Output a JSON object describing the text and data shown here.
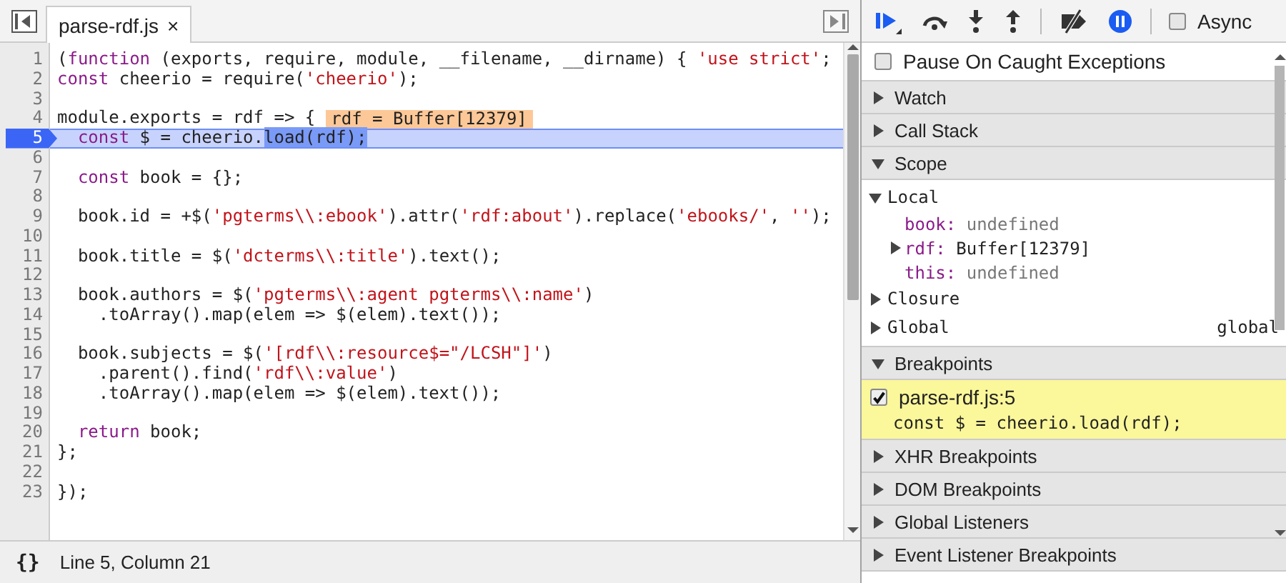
{
  "editor": {
    "tabs": [
      {
        "label": "parse-rdf.js",
        "close": "×",
        "selected": true
      }
    ],
    "lines": [
      {
        "number": "1",
        "current": false,
        "tokens": [
          {
            "kind": "plain",
            "text": "("
          },
          {
            "kind": "keyword",
            "text": "function"
          },
          {
            "kind": "plain",
            "text": " (exports, require, module, __filename, __dirname) { "
          },
          {
            "kind": "string",
            "text": "'use strict'"
          },
          {
            "kind": "plain",
            "text": ";"
          }
        ]
      },
      {
        "number": "2",
        "current": false,
        "tokens": [
          {
            "kind": "keyword",
            "text": "const"
          },
          {
            "kind": "plain",
            "text": " cheerio = require("
          },
          {
            "kind": "string",
            "text": "'cheerio'"
          },
          {
            "kind": "plain",
            "text": ");"
          }
        ]
      },
      {
        "number": "3",
        "current": false
      },
      {
        "number": "4",
        "current": false,
        "tokens": [
          {
            "kind": "plain",
            "text": "module.exports = rdf => {"
          }
        ],
        "inline_value": "rdf = Buffer[12379]"
      },
      {
        "number": "5",
        "current": true,
        "tokens": [
          {
            "kind": "keyword",
            "text": "  const"
          },
          {
            "kind": "plain",
            "text": " $ = cheerio."
          },
          {
            "kind": "selection",
            "text": "load(rdf);"
          }
        ]
      },
      {
        "number": "6",
        "current": false
      },
      {
        "number": "7",
        "current": false,
        "tokens": [
          {
            "kind": "keyword",
            "text": "  const"
          },
          {
            "kind": "plain",
            "text": " book = {};"
          }
        ]
      },
      {
        "number": "8",
        "current": false
      },
      {
        "number": "9",
        "current": false,
        "tokens": [
          {
            "kind": "plain",
            "text": "  book.id = +$("
          },
          {
            "kind": "string",
            "text": "'pgterms\\\\:ebook'"
          },
          {
            "kind": "plain",
            "text": ").attr("
          },
          {
            "kind": "string",
            "text": "'rdf:about'"
          },
          {
            "kind": "plain",
            "text": ").replace("
          },
          {
            "kind": "string",
            "text": "'ebooks/'"
          },
          {
            "kind": "plain",
            "text": ", "
          },
          {
            "kind": "string",
            "text": "''"
          },
          {
            "kind": "plain",
            "text": ");"
          }
        ]
      },
      {
        "number": "10",
        "current": false
      },
      {
        "number": "11",
        "current": false,
        "tokens": [
          {
            "kind": "plain",
            "text": "  book.title = $("
          },
          {
            "kind": "string",
            "text": "'dcterms\\\\:title'"
          },
          {
            "kind": "plain",
            "text": ").text();"
          }
        ]
      },
      {
        "number": "12",
        "current": false
      },
      {
        "number": "13",
        "current": false,
        "tokens": [
          {
            "kind": "plain",
            "text": "  book.authors = $("
          },
          {
            "kind": "string",
            "text": "'pgterms\\\\:agent pgterms\\\\:name'"
          },
          {
            "kind": "plain",
            "text": ")"
          }
        ]
      },
      {
        "number": "14",
        "current": false,
        "tokens": [
          {
            "kind": "plain",
            "text": "    .toArray().map(elem => $(elem).text());"
          }
        ]
      },
      {
        "number": "15",
        "current": false
      },
      {
        "number": "16",
        "current": false,
        "tokens": [
          {
            "kind": "plain",
            "text": "  book.subjects = $("
          },
          {
            "kind": "string",
            "text": "'[rdf\\\\:resource$=\"/LCSH\"]'"
          },
          {
            "kind": "plain",
            "text": ")"
          }
        ]
      },
      {
        "number": "17",
        "current": false,
        "tokens": [
          {
            "kind": "plain",
            "text": "    .parent().find("
          },
          {
            "kind": "string",
            "text": "'rdf\\\\:value'"
          },
          {
            "kind": "plain",
            "text": ")"
          }
        ]
      },
      {
        "number": "18",
        "current": false,
        "tokens": [
          {
            "kind": "plain",
            "text": "    .toArray().map(elem => $(elem).text());"
          }
        ]
      },
      {
        "number": "19",
        "current": false
      },
      {
        "number": "20",
        "current": false,
        "tokens": [
          {
            "kind": "keyword",
            "text": "  return"
          },
          {
            "kind": "plain",
            "text": " book;"
          }
        ]
      },
      {
        "number": "21",
        "current": false,
        "tokens": [
          {
            "kind": "plain",
            "text": "};"
          }
        ]
      },
      {
        "number": "22",
        "current": false
      },
      {
        "number": "23",
        "current": false,
        "tokens": [
          {
            "kind": "plain",
            "text": "});"
          }
        ]
      }
    ],
    "status_bar": {
      "format_button": "{}",
      "position": "Line 5, Column 21"
    }
  },
  "debugger": {
    "toolbar": {
      "pause_on_exceptions": true,
      "async": {
        "label": "Async",
        "checked": false
      }
    },
    "pause_on_caught": {
      "label": "Pause On Caught Exceptions",
      "checked": false
    },
    "sections": [
      {
        "title": "Watch",
        "kind": "plain",
        "expanded": false
      },
      {
        "title": "Call Stack",
        "kind": "plain",
        "expanded": false
      },
      {
        "title": "Scope",
        "kind": "scope",
        "expanded": true,
        "scopes": [
          {
            "label": "Local",
            "expanded": true,
            "variables": [
              {
                "name": "book:",
                "value": "undefined",
                "kind": "undefined",
                "expandable": false
              },
              {
                "name": "rdf:",
                "value": "Buffer[12379]",
                "kind": "object",
                "expandable": true
              },
              {
                "name": "this:",
                "value": "undefined",
                "kind": "undefined",
                "expandable": false
              }
            ]
          },
          {
            "label": "Closure",
            "expanded": false
          },
          {
            "label": "Global",
            "expanded": false,
            "value": "global"
          }
        ]
      },
      {
        "title": "Breakpoints",
        "kind": "breakpoints",
        "expanded": true,
        "breakpoints": [
          {
            "location": "parse-rdf.js:5",
            "code": "const $ = cheerio.load(rdf);",
            "checked": true,
            "hit": true
          }
        ]
      },
      {
        "title": "XHR Breakpoints",
        "kind": "plain",
        "expanded": false
      },
      {
        "title": "DOM Breakpoints",
        "kind": "plain",
        "expanded": false
      },
      {
        "title": "Global Listeners",
        "kind": "plain",
        "expanded": false
      },
      {
        "title": "Event Listener Breakpoints",
        "kind": "plain",
        "expanded": false
      }
    ]
  }
}
